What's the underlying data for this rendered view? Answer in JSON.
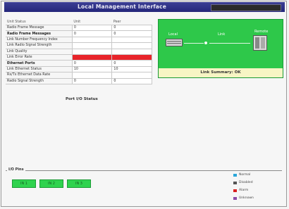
{
  "window": {
    "title": "Local Management Interface",
    "badge": ""
  },
  "status_table": {
    "header": [
      "Unit Status",
      "Unit",
      "Peer"
    ],
    "rows": [
      {
        "label": "Radio Frame Message",
        "a": "0",
        "b": "0",
        "kind": "normal"
      },
      {
        "label": "Radio Frame Messages",
        "a": "0",
        "b": "0",
        "kind": "section"
      },
      {
        "label": "Link Number Frequency Index",
        "a": "",
        "b": "",
        "kind": "normal"
      },
      {
        "label": "Link Radio Signal Strength",
        "a": "",
        "b": "",
        "kind": "normal"
      },
      {
        "label": "Link Quality",
        "a": "",
        "b": "",
        "kind": "normal"
      },
      {
        "label": "Link Error Rate",
        "a": "",
        "b": "",
        "kind": "alarm"
      },
      {
        "label": "Ethernet Ports",
        "a": "0",
        "b": "0",
        "kind": "section"
      },
      {
        "label": "Link Ethernet Status",
        "a": "10",
        "b": "10",
        "kind": "normal"
      },
      {
        "label": "Rx/Tx Ethernet Data Rate",
        "a": "",
        "b": "",
        "kind": "normal"
      },
      {
        "label": "Radio Signal Strength",
        "a": "0",
        "b": "0",
        "kind": "normal"
      }
    ]
  },
  "port_section_title": "Port I/O Status",
  "diagram": {
    "left_device_label": "Local",
    "center_label": "Link",
    "right_device_label": "Remote",
    "footer_text": "Link Summary: OK"
  },
  "bottom": {
    "label": "I/O Pins",
    "buttons": [
      "IN 1",
      "IN 2",
      "IN 3"
    ]
  },
  "legend": [
    {
      "label": "Normal",
      "color": "#2aa6d8"
    },
    {
      "label": "Disabled",
      "color": "#555555"
    },
    {
      "label": "Alarm",
      "color": "#d82020"
    },
    {
      "label": "Unknown",
      "color": "#8a4aa8"
    }
  ]
}
